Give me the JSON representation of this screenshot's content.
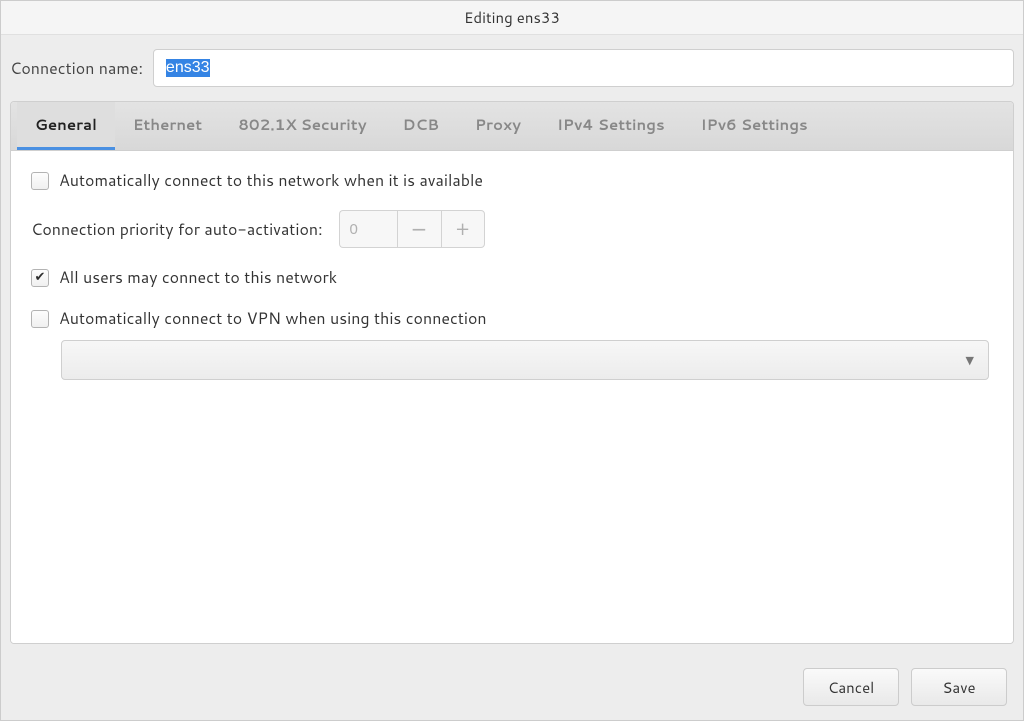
{
  "window": {
    "title": "Editing ens33"
  },
  "connection": {
    "name_label": "Connection name:",
    "name_value": "ens33"
  },
  "tabs": [
    {
      "label": "General",
      "active": true
    },
    {
      "label": "Ethernet",
      "active": false
    },
    {
      "label": "802.1X Security",
      "active": false
    },
    {
      "label": "DCB",
      "active": false
    },
    {
      "label": "Proxy",
      "active": false
    },
    {
      "label": "IPv4 Settings",
      "active": false
    },
    {
      "label": "IPv6 Settings",
      "active": false
    }
  ],
  "general": {
    "auto_connect_label": "Automatically connect to this network when it is available",
    "auto_connect_checked": false,
    "priority_label": "Connection priority for auto-activation:",
    "priority_value": "0",
    "all_users_label": "All users may connect to this network",
    "all_users_checked": true,
    "auto_vpn_label": "Automatically connect to VPN when using this connection",
    "auto_vpn_checked": false,
    "vpn_selected": ""
  },
  "buttons": {
    "cancel": "Cancel",
    "save": "Save"
  }
}
